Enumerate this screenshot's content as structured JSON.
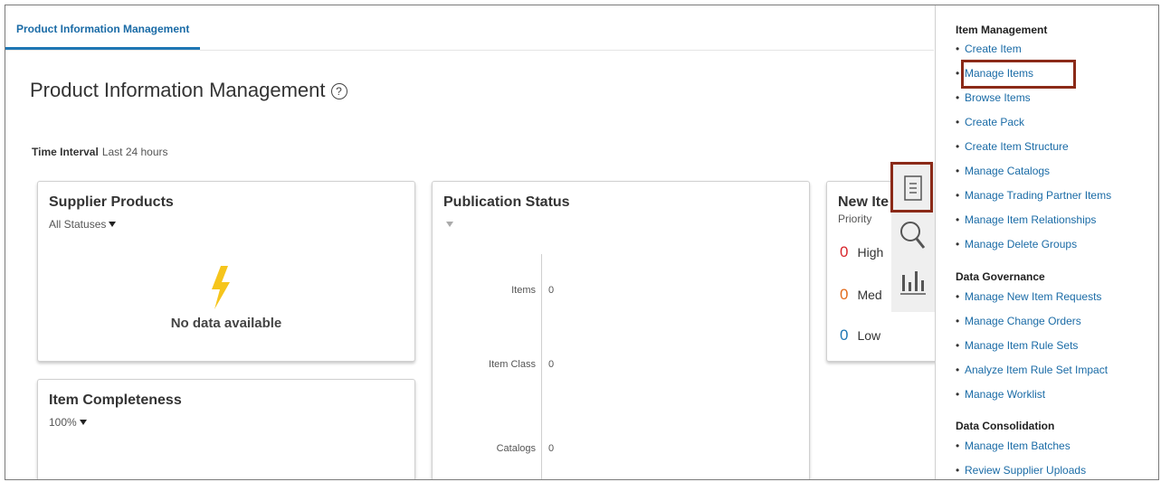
{
  "tab": {
    "label": "Product Information Management"
  },
  "page": {
    "title": "Product Information Management",
    "help": "?"
  },
  "time_interval": {
    "label": "Time Interval",
    "value": "Last 24 hours"
  },
  "supplier_products": {
    "title": "Supplier Products",
    "filter": "All Statuses",
    "empty": "No data available"
  },
  "publication_status": {
    "title": "Publication Status",
    "rows": [
      {
        "label": "Items",
        "value": "0"
      },
      {
        "label": "Item Class",
        "value": "0"
      },
      {
        "label": "Catalogs",
        "value": "0"
      }
    ]
  },
  "new_items": {
    "title": "New Ite",
    "subtitle": "Priority",
    "rows": [
      {
        "count": "0",
        "label": "High",
        "color": "#d8262c"
      },
      {
        "count": "0",
        "label": "Med",
        "color": "#e26b1c"
      },
      {
        "count": "0",
        "label": "Low",
        "color": "#1f77b4"
      }
    ]
  },
  "item_completeness": {
    "title": "Item Completeness",
    "filter": "100%"
  },
  "colors": {
    "link": "#1a6ba6",
    "highlight": "#8b2a18",
    "bolt": "#f6c51c"
  },
  "tasks_panel": {
    "sections": [
      {
        "title": "Item Management",
        "items": [
          "Create Item",
          "Manage Items",
          "Browse Items",
          "Create Pack",
          "Create Item Structure",
          "Manage Catalogs",
          "Manage Trading Partner Items",
          "Manage Item Relationships",
          "Manage Delete Groups"
        ]
      },
      {
        "title": "Data Governance",
        "items": [
          "Manage New Item Requests",
          "Manage Change Orders",
          "Manage Item Rule Sets",
          "Analyze Item Rule Set Impact",
          "Manage Worklist"
        ]
      },
      {
        "title": "Data Consolidation",
        "items": [
          "Manage Item Batches",
          "Review Supplier Uploads"
        ]
      }
    ]
  }
}
